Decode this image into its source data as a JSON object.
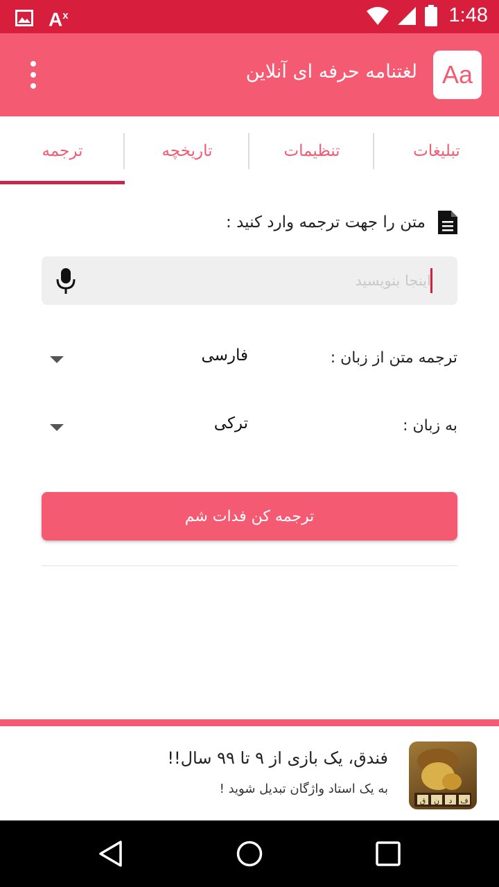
{
  "status_bar": {
    "time": "1:48",
    "icons": [
      "image-icon",
      "translate-icon",
      "wifi-icon",
      "signal-icon",
      "battery-icon"
    ],
    "translate_glyph": "A",
    "translate_glyph_sup": "x"
  },
  "app_bar": {
    "logo_text": "Aa",
    "title": "لغتنامه حرفه ای آنلاین",
    "background_color": "#f45b73"
  },
  "tabs": [
    {
      "label": "تبلیغات"
    },
    {
      "label": "تنظیمات"
    },
    {
      "label": "تاریخچه"
    },
    {
      "label": "ترجمه",
      "active": true
    }
  ],
  "main": {
    "prompt": "متن را جهت ترجمه وارد کنید :",
    "input_placeholder": "اینجا بنویسید",
    "input_value": "",
    "source_label": "ترجمه متن از زبان :",
    "source_value": "فارسی",
    "target_label": "به زبان :",
    "target_value": "ترکی",
    "translate_button": "ترجمه کن فدات شم"
  },
  "ad": {
    "headline": "فندق، یک بازی از ۹ تا ۹۹ سال!!",
    "body": "به یک استاد واژگان تبدیل شوید !",
    "icon_letters": [
      "ق",
      "ن",
      "د",
      "ف"
    ]
  },
  "colors": {
    "status_bar": "#d71f3d",
    "accent": "#f45b73",
    "active_tab_indicator": "#c8264a"
  }
}
